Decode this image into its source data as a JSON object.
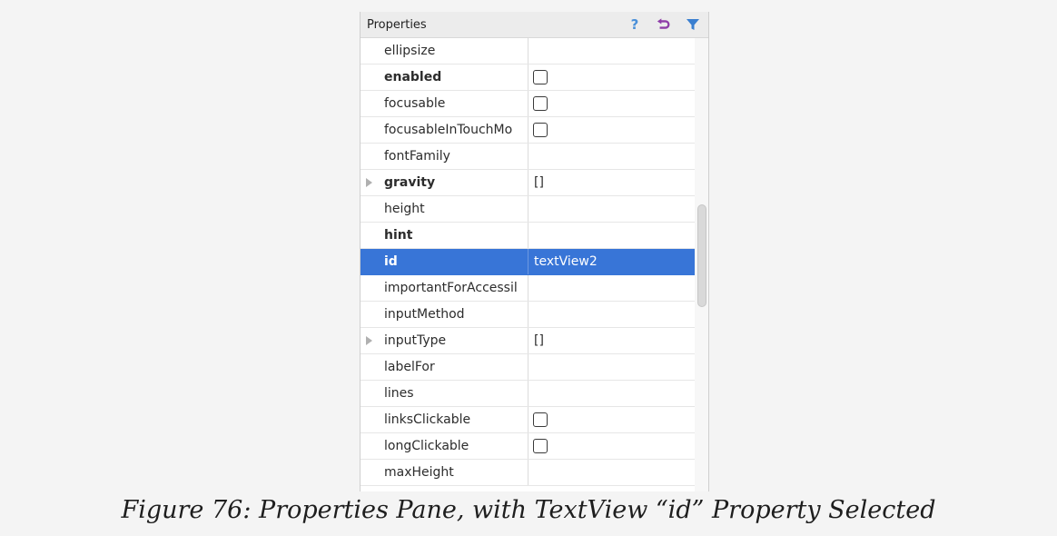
{
  "panel": {
    "title": "Properties",
    "icons": [
      "help-icon",
      "undo-icon",
      "filter-icon"
    ],
    "accent_colors": {
      "help": "#4a90d9",
      "undo": "#8e3da8",
      "filter": "#3a7fd0",
      "selection": "#3875d7"
    }
  },
  "rows": [
    {
      "name": "ellipsize",
      "bold": false,
      "expandable": false,
      "type": "text",
      "value": ""
    },
    {
      "name": "enabled",
      "bold": true,
      "expandable": false,
      "type": "checkbox",
      "value": ""
    },
    {
      "name": "focusable",
      "bold": false,
      "expandable": false,
      "type": "checkbox",
      "value": ""
    },
    {
      "name": "focusableInTouchMo",
      "bold": false,
      "expandable": false,
      "type": "checkbox",
      "value": ""
    },
    {
      "name": "fontFamily",
      "bold": false,
      "expandable": false,
      "type": "text",
      "value": ""
    },
    {
      "name": "gravity",
      "bold": true,
      "expandable": true,
      "type": "text",
      "value": "[]"
    },
    {
      "name": "height",
      "bold": false,
      "expandable": false,
      "type": "text",
      "value": ""
    },
    {
      "name": "hint",
      "bold": true,
      "expandable": false,
      "type": "text",
      "value": ""
    },
    {
      "name": "id",
      "bold": true,
      "expandable": false,
      "type": "text",
      "value": "textView2",
      "selected": true
    },
    {
      "name": "importantForAccessil",
      "bold": false,
      "expandable": false,
      "type": "text",
      "value": ""
    },
    {
      "name": "inputMethod",
      "bold": false,
      "expandable": false,
      "type": "text",
      "value": ""
    },
    {
      "name": "inputType",
      "bold": false,
      "expandable": true,
      "type": "text",
      "value": "[]"
    },
    {
      "name": "labelFor",
      "bold": false,
      "expandable": false,
      "type": "text",
      "value": ""
    },
    {
      "name": "lines",
      "bold": false,
      "expandable": false,
      "type": "text",
      "value": ""
    },
    {
      "name": "linksClickable",
      "bold": false,
      "expandable": false,
      "type": "checkbox",
      "value": ""
    },
    {
      "name": "longClickable",
      "bold": false,
      "expandable": false,
      "type": "checkbox",
      "value": ""
    },
    {
      "name": "maxHeight",
      "bold": false,
      "expandable": false,
      "type": "text",
      "value": ""
    }
  ],
  "caption": "Figure 76: Properties Pane, with TextView “id” Property Selected"
}
